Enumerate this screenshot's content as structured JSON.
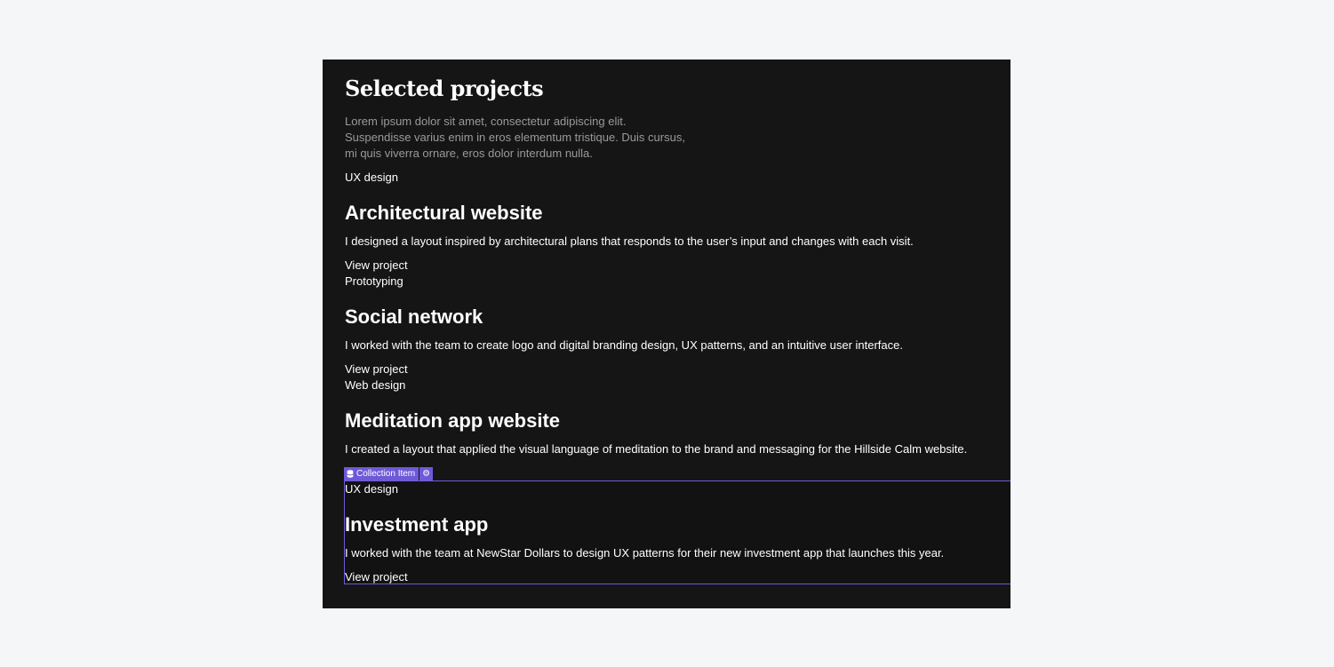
{
  "section": {
    "title": "Selected projects",
    "intro_lines": [
      "Lorem ipsum dolor sit amet, consectetur adipiscing elit.",
      "Suspendisse varius enim in eros elementum tristique. Duis cursus,",
      "mi quis viverra ornare, eros dolor interdum nulla."
    ]
  },
  "projects": [
    {
      "tag": "UX design",
      "title": "Architectural website",
      "description": "I designed a layout inspired by architectural plans that responds to the user’s input and changes with each visit.",
      "link": "View project"
    },
    {
      "tag": "Prototyping",
      "title": "Social network",
      "description": "I worked with the team to create logo and digital branding design, UX patterns, and an intuitive user interface.",
      "link": "View project"
    },
    {
      "tag": "Web design",
      "title": "Meditation app website",
      "description": "I created a layout that applied the visual language of meditation to the brand and messaging for the Hillside Calm website.",
      "link": ""
    },
    {
      "tag": "UX design",
      "title": "Investment app",
      "description": "I worked with the team at NewStar Dollars to design UX patterns for their new investment app that launches this year.",
      "link": "View project"
    }
  ],
  "selection": {
    "label": "Collection Item",
    "icon": "database-icon",
    "settings_icon": "gear-icon",
    "accent_color": "#6e5ad8"
  },
  "colors": {
    "page_background": "#f5f6f8",
    "canvas_background": "#151515",
    "muted_text": "#9a9a9a"
  }
}
